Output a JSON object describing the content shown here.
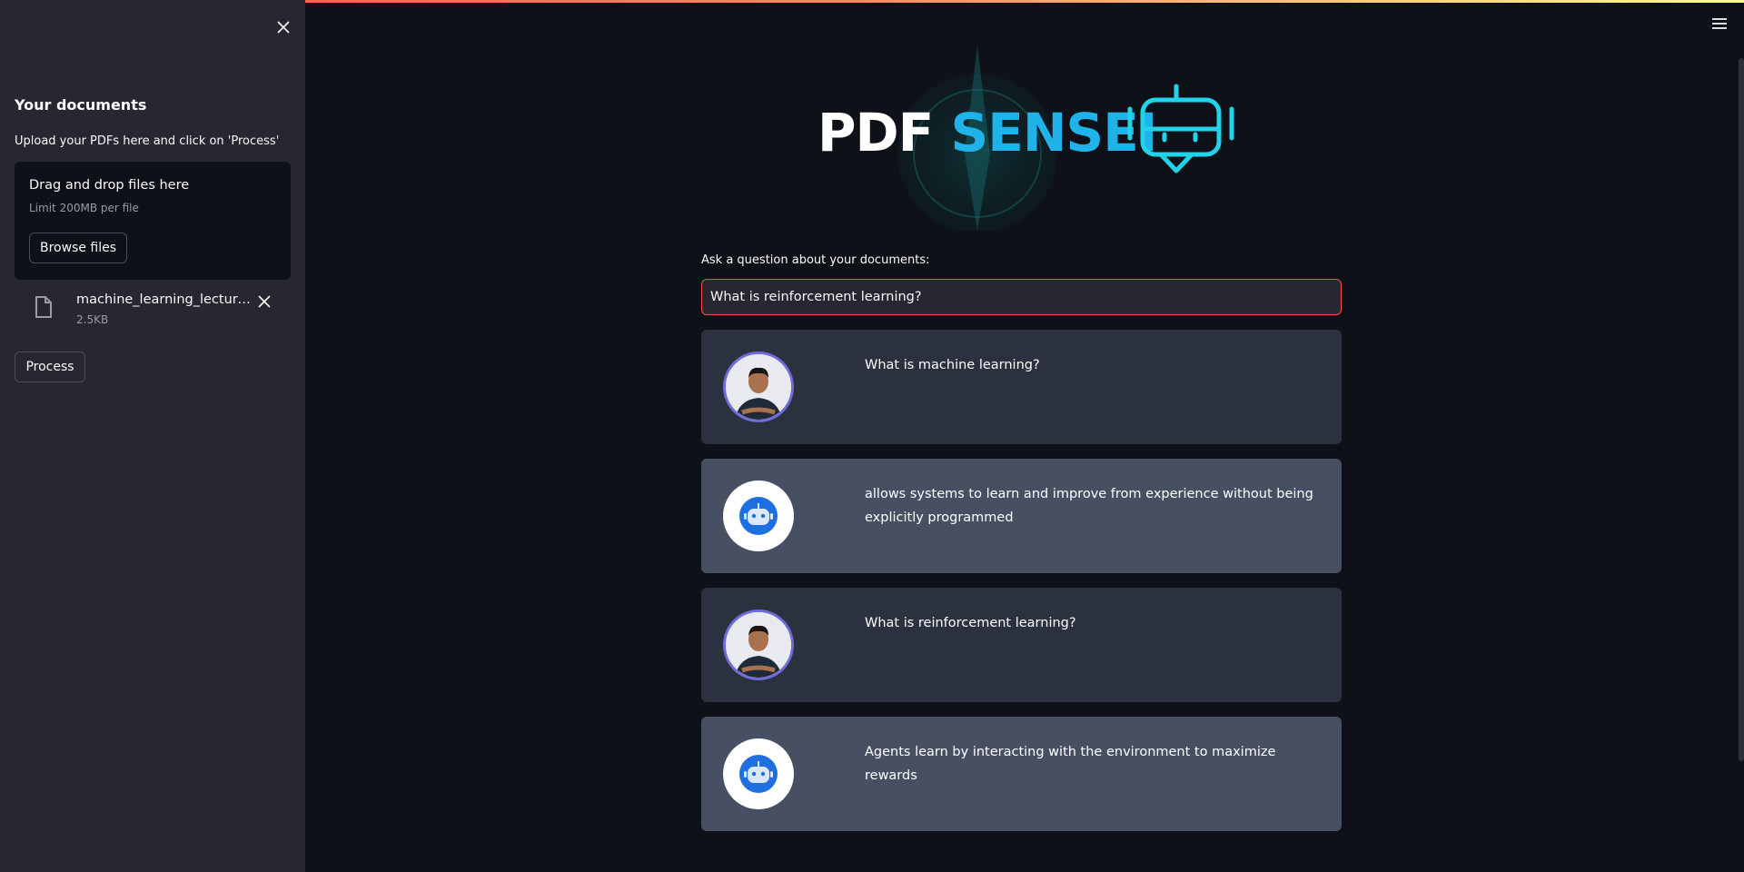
{
  "sidebar": {
    "title": "Your documents",
    "subtitle": "Upload your PDFs here and click on 'Process'",
    "dropzone": {
      "title": "Drag and drop files here",
      "limit": "Limit 200MB per file",
      "browse_label": "Browse files"
    },
    "file": {
      "name": "machine_learning_lecture_...",
      "size": "2.5KB"
    },
    "process_label": "Process"
  },
  "logo": {
    "part1": "PDF",
    "part2": "SENSEI"
  },
  "question": {
    "label": "Ask a question about your documents:",
    "value": "What is reinforcement learning?"
  },
  "messages": [
    {
      "role": "user",
      "text": "What is machine learning?"
    },
    {
      "role": "bot",
      "text": "allows systems to learn and improve from experience without being explicitly programmed"
    },
    {
      "role": "user",
      "text": "What is reinforcement learning?"
    },
    {
      "role": "bot",
      "text": "Agents learn by interacting with the environment to maximize rewards"
    }
  ],
  "colors": {
    "accent": "#ff4b4b",
    "brand": "#1fb3ea",
    "robot": "#22d3e8"
  }
}
